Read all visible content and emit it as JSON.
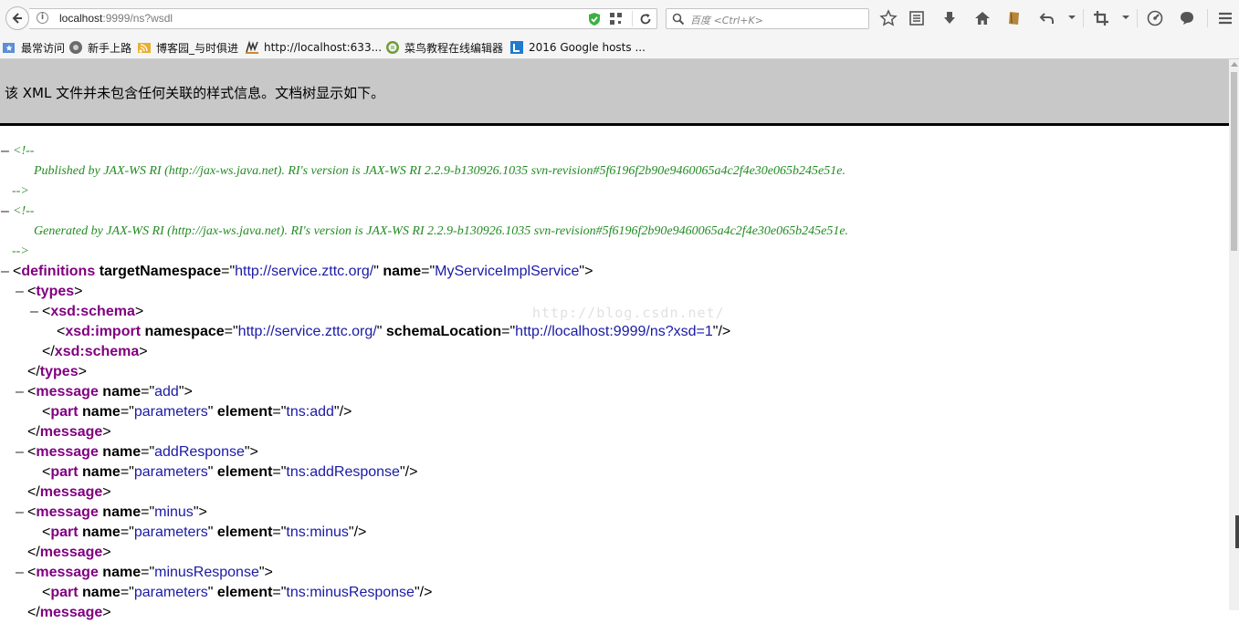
{
  "toolbar": {
    "url_host": "localhost",
    "url_rest": ":9999/ns?wsdl",
    "search_placeholder": "百度 <Ctrl+K>"
  },
  "bookmarks": [
    {
      "label": "最常访问",
      "icon": "star-folder-icon"
    },
    {
      "label": "新手上路",
      "icon": "firefox-icon"
    },
    {
      "label": "博客园_与时俱进",
      "icon": "rss-feed-icon"
    },
    {
      "label": "http://localhost:633...",
      "icon": "page-favicon-icon"
    },
    {
      "label": "菜鸟教程在线编辑器",
      "icon": "runoob-icon"
    },
    {
      "label": "2016 Google hosts ...",
      "icon": "bookmark-l-icon"
    }
  ],
  "info_banner": {
    "text": "该 XML 文件并未包含任何关联的样式信息。文档树显示如下。"
  },
  "watermark": "http://blog.csdn.net/",
  "xml": {
    "comment_open": "<!--",
    "comment_close": "-->",
    "comment1": "Published by JAX-WS RI (http://jax-ws.java.net). RI's version is JAX-WS RI 2.2.9-b130926.1035 svn-revision#5f6196f2b90e9460065a4c2f4e30e065b245e51e.",
    "comment2": "Generated by JAX-WS RI (http://jax-ws.java.net). RI's version is JAX-WS RI 2.2.9-b130926.1035 svn-revision#5f6196f2b90e9460065a4c2f4e30e065b245e51e.",
    "definitions": {
      "tag": "definitions",
      "attr1": "targetNamespace",
      "val1": "http://service.zttc.org/",
      "attr2": "name",
      "val2": "MyServiceImplService"
    },
    "types": {
      "tag": "types"
    },
    "schema": {
      "tag": "xsd:schema"
    },
    "import": {
      "tag": "xsd:import",
      "attr1": "namespace",
      "val1": "http://service.zttc.org/",
      "attr2": "schemaLocation",
      "val2": "http://localhost:9999/ns?xsd=1"
    },
    "message_tag": "message",
    "part_tag": "part",
    "name_attr": "name",
    "part_name_attr": "name",
    "part_name_val": "parameters",
    "element_attr": "element",
    "messages": [
      {
        "name": "add",
        "element": "tns:add"
      },
      {
        "name": "addResponse",
        "element": "tns:addResponse"
      },
      {
        "name": "minus",
        "element": "tns:minus"
      },
      {
        "name": "minusResponse",
        "element": "tns:minusResponse"
      }
    ]
  }
}
